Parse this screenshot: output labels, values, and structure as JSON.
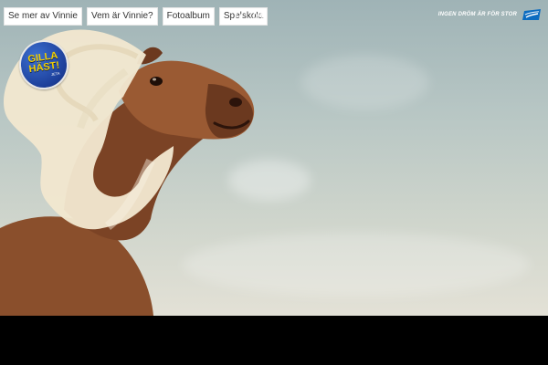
{
  "nav": {
    "items": [
      {
        "label": "Se mer av Vinnie"
      },
      {
        "label": "Vem är Vinnie?"
      },
      {
        "label": "Fotoalbum"
      },
      {
        "label": "Spelskola"
      }
    ]
  },
  "social": {
    "facebook_icon": "facebook-icon",
    "share_icon": "share-icon"
  },
  "brand": {
    "tagline": "INGEN DRÖM ÄR FÖR STOR",
    "logo_icon": "flag-logo-icon"
  },
  "badge": {
    "line1": "GILLA",
    "line2": "HÄST!",
    "small": "JETA"
  },
  "colors": {
    "sky_top": "#9fb3b6",
    "sky_bottom": "#e3e1d6",
    "badge_blue": "#1d3f9a",
    "badge_yellow": "#f3d000",
    "horse_brown": "#8a4f2c",
    "mane": "#f1e7cf"
  }
}
